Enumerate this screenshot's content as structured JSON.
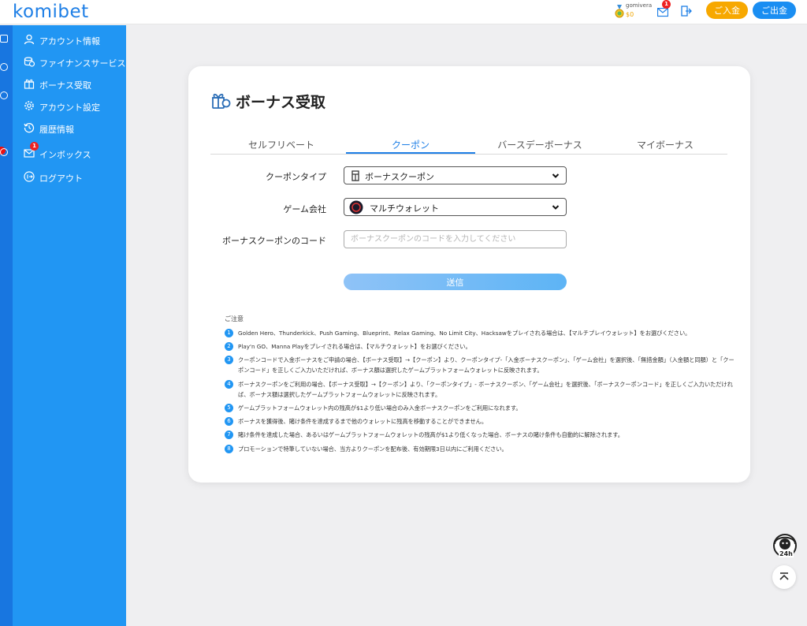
{
  "header": {
    "logo": "komibet",
    "username": "gomivera",
    "balance": "$0",
    "mail_badge": "1",
    "deposit_label": "ご入金",
    "withdraw_label": "ご出金"
  },
  "sidebar": {
    "items": [
      {
        "label": "アカウント情報",
        "icon": "user-icon"
      },
      {
        "label": "ファイナンスサービス",
        "icon": "coins-icon"
      },
      {
        "label": "ボーナス受取",
        "icon": "gift-icon"
      },
      {
        "label": "アカウント設定",
        "icon": "gear-icon"
      },
      {
        "label": "履歴情報",
        "icon": "history-icon"
      },
      {
        "label": "インボックス",
        "icon": "mail-icon",
        "badge": "1"
      },
      {
        "label": "ログアウト",
        "icon": "logout-icon"
      }
    ]
  },
  "page": {
    "title": "ボーナス受取",
    "tabs": [
      "セルフリベート",
      "クーポン",
      "バースデーボーナス",
      "マイボーナス"
    ],
    "active_tab": "クーポン"
  },
  "form": {
    "coupon_type_label": "クーポンタイプ",
    "coupon_type_value": "ボーナスクーポン",
    "provider_label": "ゲーム会社",
    "provider_value": "マルチウォレット",
    "code_label": "ボーナスクーポンのコード",
    "code_placeholder": "ボーナスクーポンのコードを入力してください",
    "submit_label": "送信"
  },
  "notes": {
    "title": "ご注意",
    "items": [
      {
        "num": "1",
        "text": "Golden Hero、Thunderkick、Push Gaming、Blueprint、Relax Gaming、No Limit City、Hacksawをプレイされる場合は、【マルチプレイウォレット】をお選びください。"
      },
      {
        "num": "2",
        "text": "Play'n GO、Manna Playをプレイされる場合は、【マルチウォレット】をお選びください。"
      },
      {
        "num": "3",
        "text": "クーポンコードで入金ボーナスをご申請の場合、【ボーナス受取】→【クーポン】より、クーポンタイプ-「入金ボーナスクーポン」、「ゲーム会社」を選択後、「無措金額」（入金額と同額）と「クーポンコード」を正しくご入力いただければ、ボーナス額は選択したゲームプラットフォームウォレットに反映されます。"
      },
      {
        "num": "4",
        "text": "ボーナスクーポンをご利用の場合、【ボーナス受取】→【クーポン】より、「クーポンタイプ」- ボーナスクーポン、「ゲーム会社」を選択後、「ボーナスクーポンコード」を正しくご入力いただければ、ボーナス額は選択したゲームプラットフォームウォレットに反映されます。"
      },
      {
        "num": "5",
        "text": "ゲームプラットフォームウォレット内の残高が$1より低い場合のみ入金ボーナスクーポンをご利用になれます。"
      },
      {
        "num": "6",
        "text": "ボーナスを獲得後、賭け条件を達成するまで他のウォレットに残高を移動することができません。"
      },
      {
        "num": "7",
        "text": "賭け条件を達成した場合、あるいはゲームプラットフォームウォレットの残高が$1より低くなった場合、ボーナスの賭け条件も自動的に解除されます。"
      },
      {
        "num": "8",
        "text": "プロモーションで特筆していない場合、当方よりクーポンを配布後、有効期限3日以内にご利用ください。"
      }
    ]
  },
  "floating": {
    "support_label": "24h"
  },
  "colors": {
    "primary": "#2196f3",
    "deposit": "#f7a800",
    "withdraw": "#1a8ef2"
  }
}
